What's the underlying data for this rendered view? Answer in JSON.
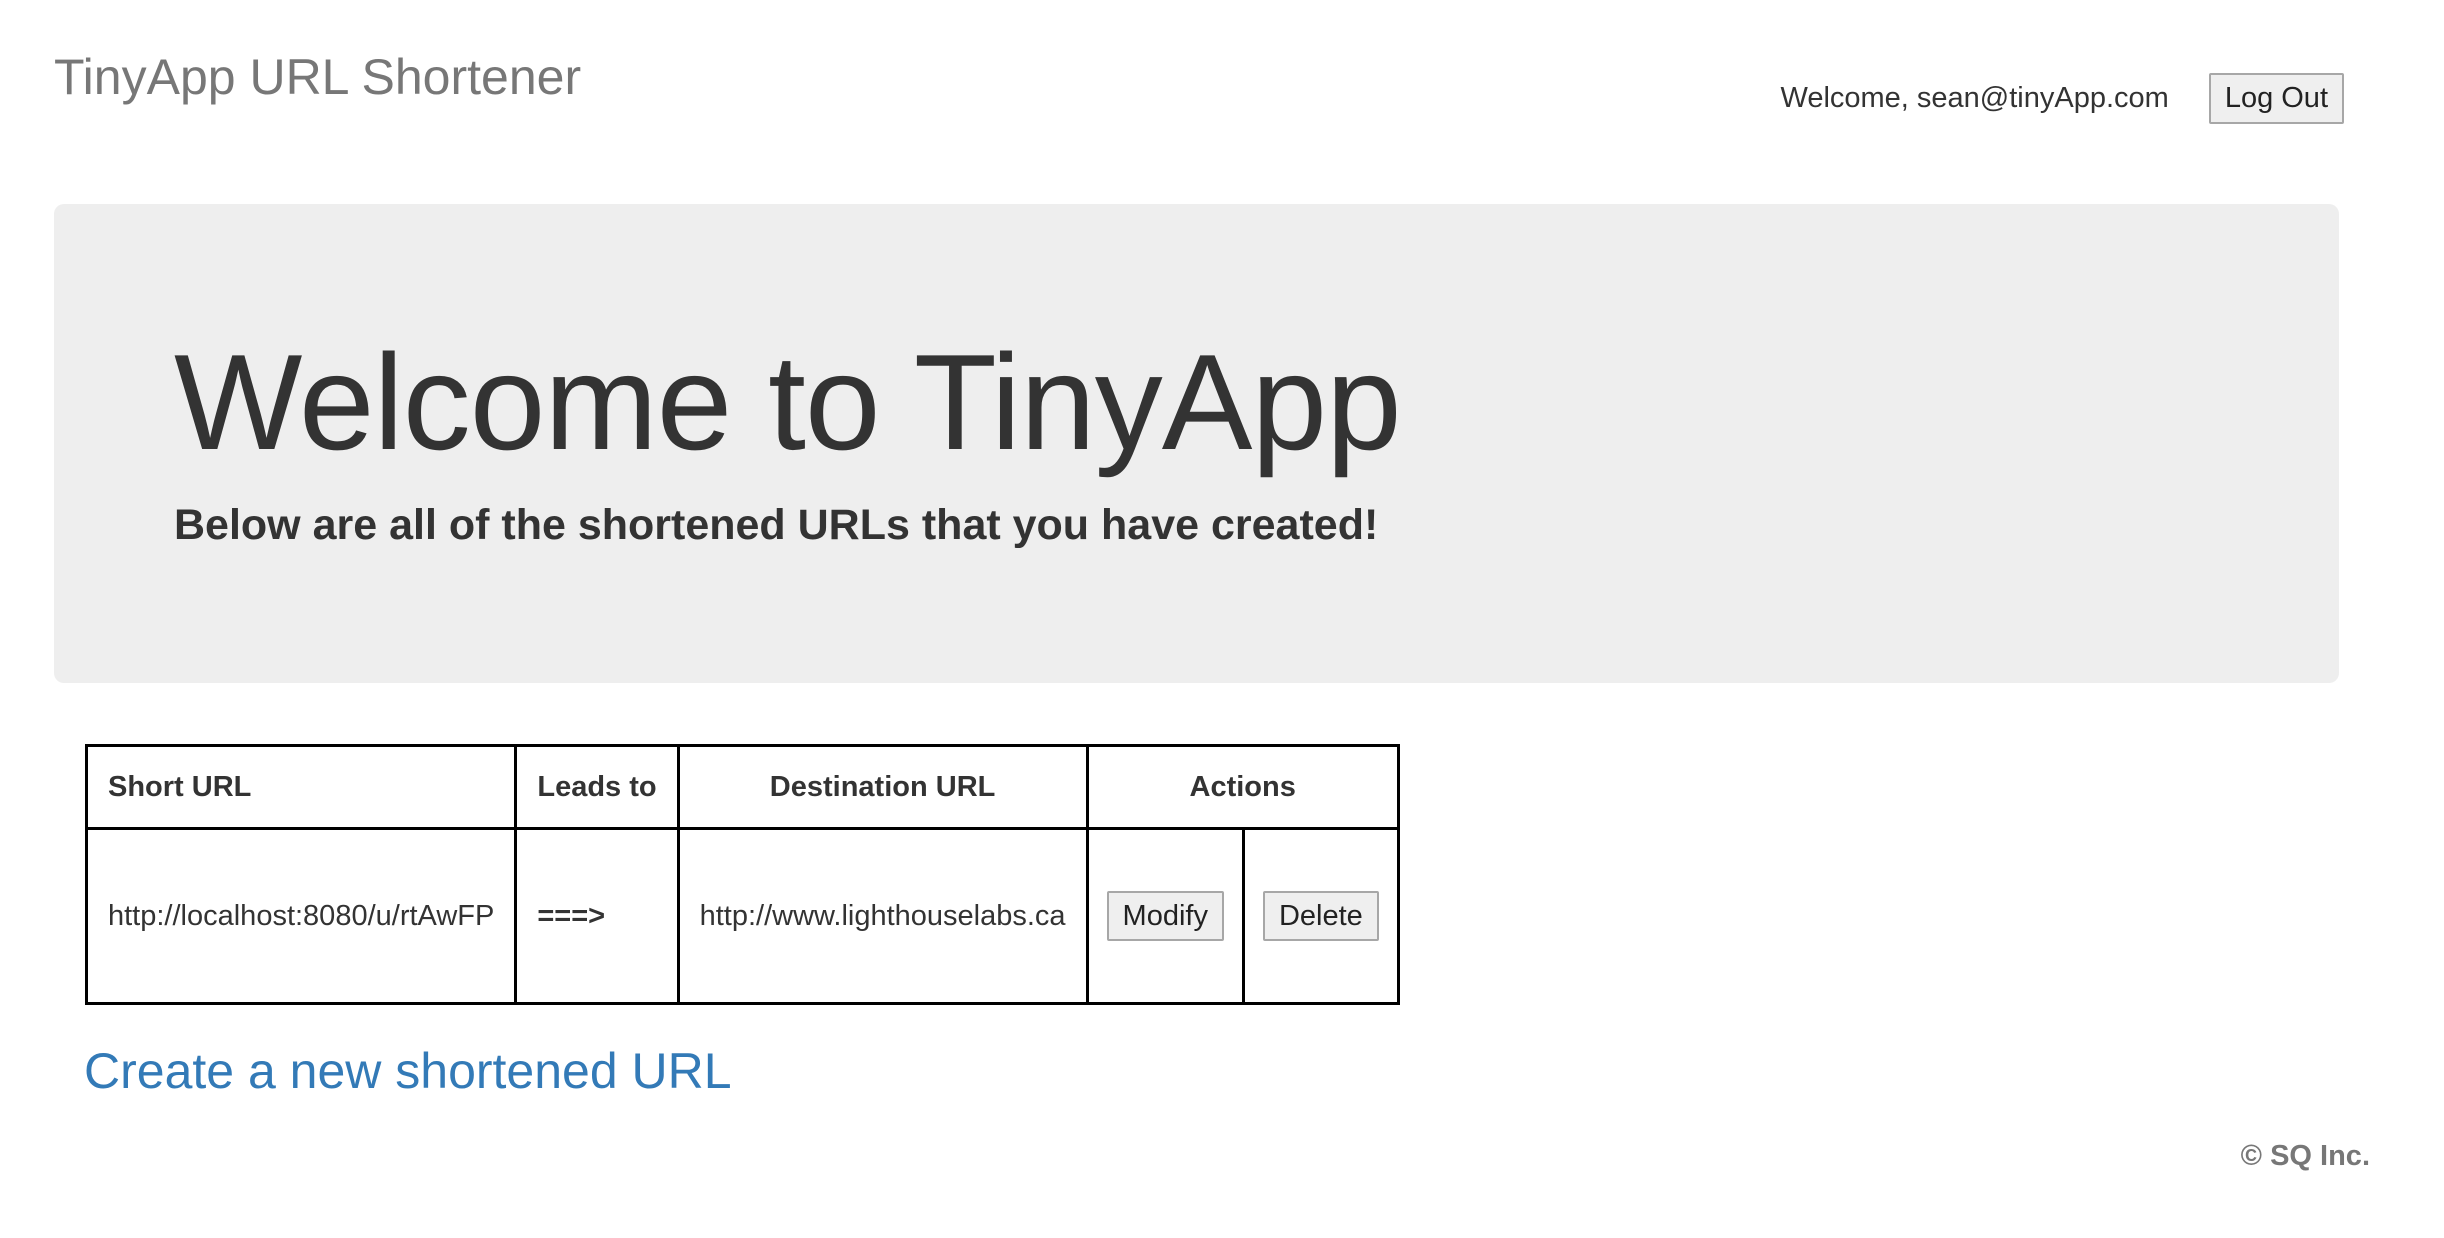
{
  "navbar": {
    "brand": "TinyApp URL Shortener",
    "welcome": "Welcome, sean@tinyApp.com",
    "logout_label": "Log Out"
  },
  "jumbotron": {
    "title": "Welcome to TinyApp",
    "subtitle": "Below are all of the shortened URLs that you have created!"
  },
  "table": {
    "headers": {
      "short_url": "Short URL",
      "leads_to": "Leads to",
      "destination_url": "Destination URL",
      "actions": "Actions"
    },
    "rows": [
      {
        "short_url": "http://localhost:8080/u/rtAwFP",
        "arrow": "===>",
        "destination_url": "http://www.lighthouselabs.ca",
        "modify_label": "Modify",
        "delete_label": "Delete"
      }
    ]
  },
  "create_link": "Create a new shortened URL",
  "footer": "© SQ Inc."
}
